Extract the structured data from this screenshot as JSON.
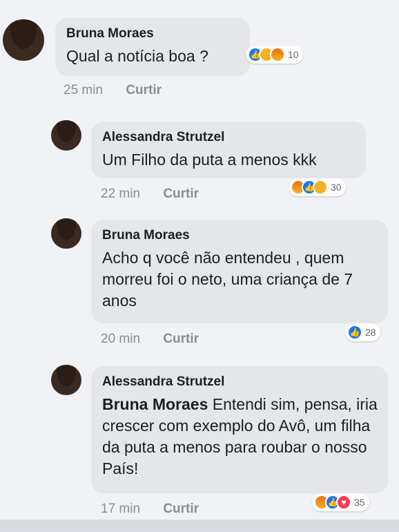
{
  "comments": [
    {
      "author": "Bruna Moraes",
      "text": "Qual a notícia boa ?",
      "mention": "",
      "time": "25 min",
      "action": "Curtir",
      "reactions": [
        "like-icon",
        "sad-icon",
        "angry-icon"
      ],
      "reaction_count": "10"
    },
    {
      "author": "Alessandra Strutzel",
      "text": "Um Filho da puta a menos kkk",
      "mention": "",
      "time": "22 min",
      "action": "Curtir",
      "reactions": [
        "angry-icon",
        "like-icon",
        "sad-icon"
      ],
      "reaction_count": "30"
    },
    {
      "author": "Bruna Moraes",
      "text": "Acho q você não entendeu , quem morreu foi o neto, uma criança de 7 anos",
      "mention": "",
      "time": "20 min",
      "action": "Curtir",
      "reactions": [
        "like-icon"
      ],
      "reaction_count": "28"
    },
    {
      "author": "Alessandra Strutzel",
      "text": "Entendi sim, pensa, iria crescer com exemplo do Avô, um filha da puta a menos para roubar o nosso País!",
      "mention": "Bruna Moraes",
      "time": "17 min",
      "action": "Curtir",
      "reactions": [
        "angry-icon",
        "like-icon",
        "love-icon"
      ],
      "reaction_count": "35"
    }
  ],
  "colors": {
    "like": "#1877f2",
    "sad": "#f7b125",
    "angry": "#e9710f",
    "love": "#f33e58"
  }
}
